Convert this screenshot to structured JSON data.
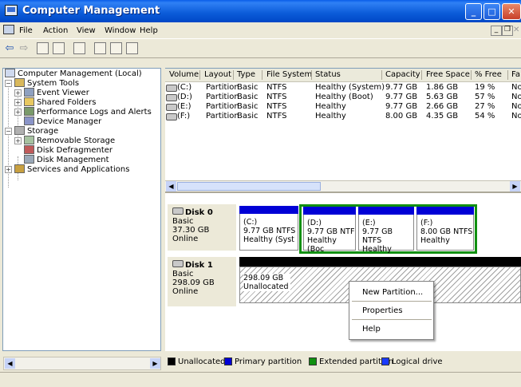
{
  "window": {
    "title": "Computer Management"
  },
  "menu": {
    "items": [
      "File",
      "Action",
      "View",
      "Window",
      "Help"
    ]
  },
  "toolbar": {
    "icons": [
      "back-arrow-icon",
      "forward-arrow-icon",
      "up-folder-icon",
      "show-hide-tree-icon",
      "help-icon",
      "refresh-icon",
      "properties-icon",
      "export-icon"
    ],
    "back": "⇦",
    "forward": "⇨"
  },
  "tree": {
    "root": "Computer Management (Local)",
    "system_tools": "System Tools",
    "event_viewer": "Event Viewer",
    "shared_folders": "Shared Folders",
    "perf_logs": "Performance Logs and Alerts",
    "device_manager": "Device Manager",
    "storage": "Storage",
    "removable_storage": "Removable Storage",
    "disk_defrag": "Disk Defragmenter",
    "disk_management": "Disk Management",
    "services": "Services and Applications"
  },
  "volume_list": {
    "columns": [
      "Volume",
      "Layout",
      "Type",
      "File System",
      "Status",
      "Capacity",
      "Free Space",
      "% Free",
      "Fa"
    ],
    "rows": [
      {
        "volume": "(C:)",
        "layout": "Partition",
        "type": "Basic",
        "fs": "NTFS",
        "status": "Healthy (System)",
        "capacity": "9.77 GB",
        "free": "1.86 GB",
        "pct": "19 %",
        "fa": "No"
      },
      {
        "volume": "(D:)",
        "layout": "Partition",
        "type": "Basic",
        "fs": "NTFS",
        "status": "Healthy (Boot)",
        "capacity": "9.77 GB",
        "free": "5.63 GB",
        "pct": "57 %",
        "fa": "No"
      },
      {
        "volume": "(E:)",
        "layout": "Partition",
        "type": "Basic",
        "fs": "NTFS",
        "status": "Healthy",
        "capacity": "9.77 GB",
        "free": "2.66 GB",
        "pct": "27 %",
        "fa": "No"
      },
      {
        "volume": "(F:)",
        "layout": "Partition",
        "type": "Basic",
        "fs": "NTFS",
        "status": "Healthy",
        "capacity": "8.00 GB",
        "free": "4.35 GB",
        "pct": "54 %",
        "fa": "No"
      }
    ]
  },
  "disks": {
    "disk0": {
      "name": "Disk 0",
      "type": "Basic",
      "size": "37.30 GB",
      "state": "Online",
      "partitions": [
        {
          "letter": "(C:)",
          "size": "9.77 GB NTFS",
          "status": "Healthy (Syst"
        },
        {
          "letter": "(D:)",
          "size": "9.77 GB NTF",
          "status": "Healthy (Boc"
        },
        {
          "letter": "(E:)",
          "size": "9.77 GB NTFS",
          "status": "Healthy"
        },
        {
          "letter": "(F:)",
          "size": "8.00 GB NTFS",
          "status": "Healthy"
        }
      ]
    },
    "disk1": {
      "name": "Disk 1",
      "type": "Basic",
      "size": "298.09 GB",
      "state": "Online",
      "unallocated": {
        "size": "298.09 GB",
        "status": "Unallocated"
      }
    }
  },
  "context_menu": {
    "items": [
      "New Partition...",
      "Properties",
      "Help"
    ]
  },
  "legend": [
    {
      "label": "Unallocated",
      "color": "#000000"
    },
    {
      "label": "Primary partition",
      "color": "#0000d6"
    },
    {
      "label": "Extended partition",
      "color": "#109010"
    },
    {
      "label": "Logical drive",
      "color": "#1a3aff"
    }
  ],
  "colors": {
    "titlebar": "#0b5bd8",
    "primary": "#0000d6",
    "extended": "#109010"
  }
}
